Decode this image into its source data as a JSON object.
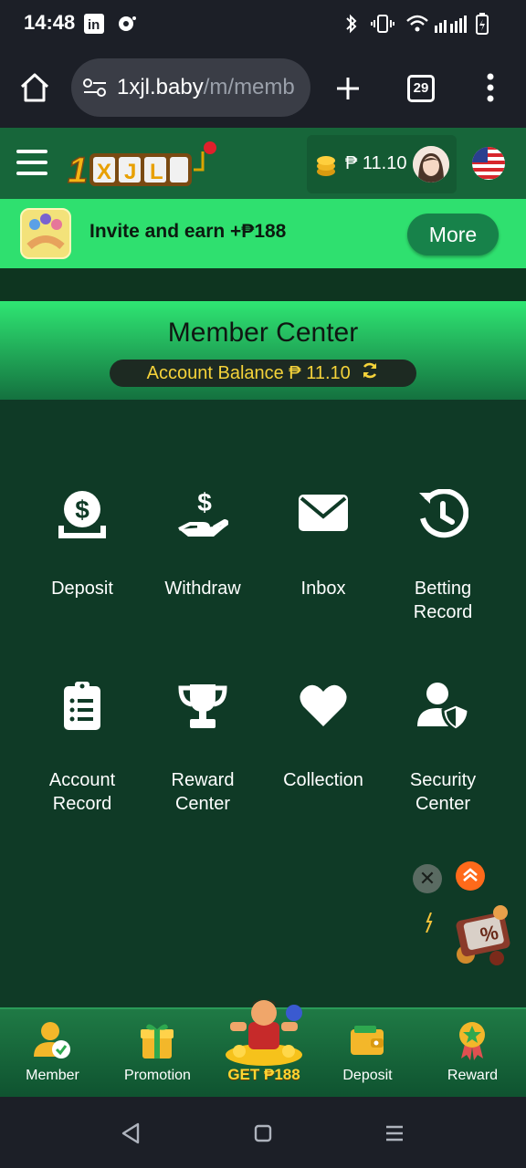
{
  "status_bar": {
    "time": "14:48",
    "icons": [
      "linkedin-icon",
      "notification-icon",
      "bluetooth-icon",
      "vibrate-icon",
      "wifi-icon",
      "signal-icon",
      "battery-icon"
    ]
  },
  "browser": {
    "url_host": "1xjl.baby",
    "url_path": "/m/memb",
    "tab_count": "29"
  },
  "header": {
    "logo_text": "1XJL",
    "balance": "₱ 11.10"
  },
  "invite_banner": {
    "text": "Invite and earn +₱188",
    "button": "More"
  },
  "member_center": {
    "title": "Member Center",
    "balance_label": "Account Balance ₱ 11.10"
  },
  "menu": {
    "deposit": "Deposit",
    "withdraw": "Withdraw",
    "inbox": "Inbox",
    "betting_record_1": "Betting",
    "betting_record_2": "Record",
    "account_record_1": "Account",
    "account_record_2": "Record",
    "reward_center_1": "Reward",
    "reward_center_2": "Center",
    "collection": "Collection",
    "security_center_1": "Security",
    "security_center_2": "Center"
  },
  "bottom_nav": {
    "member": "Member",
    "promotion": "Promotion",
    "center": "GET ₱188",
    "deposit": "Deposit",
    "reward": "Reward"
  },
  "colors": {
    "header_green": "#17663a",
    "banner_green": "#2fe06f",
    "page_bg": "#0f3a26",
    "balance_gold": "#f5d33a"
  }
}
